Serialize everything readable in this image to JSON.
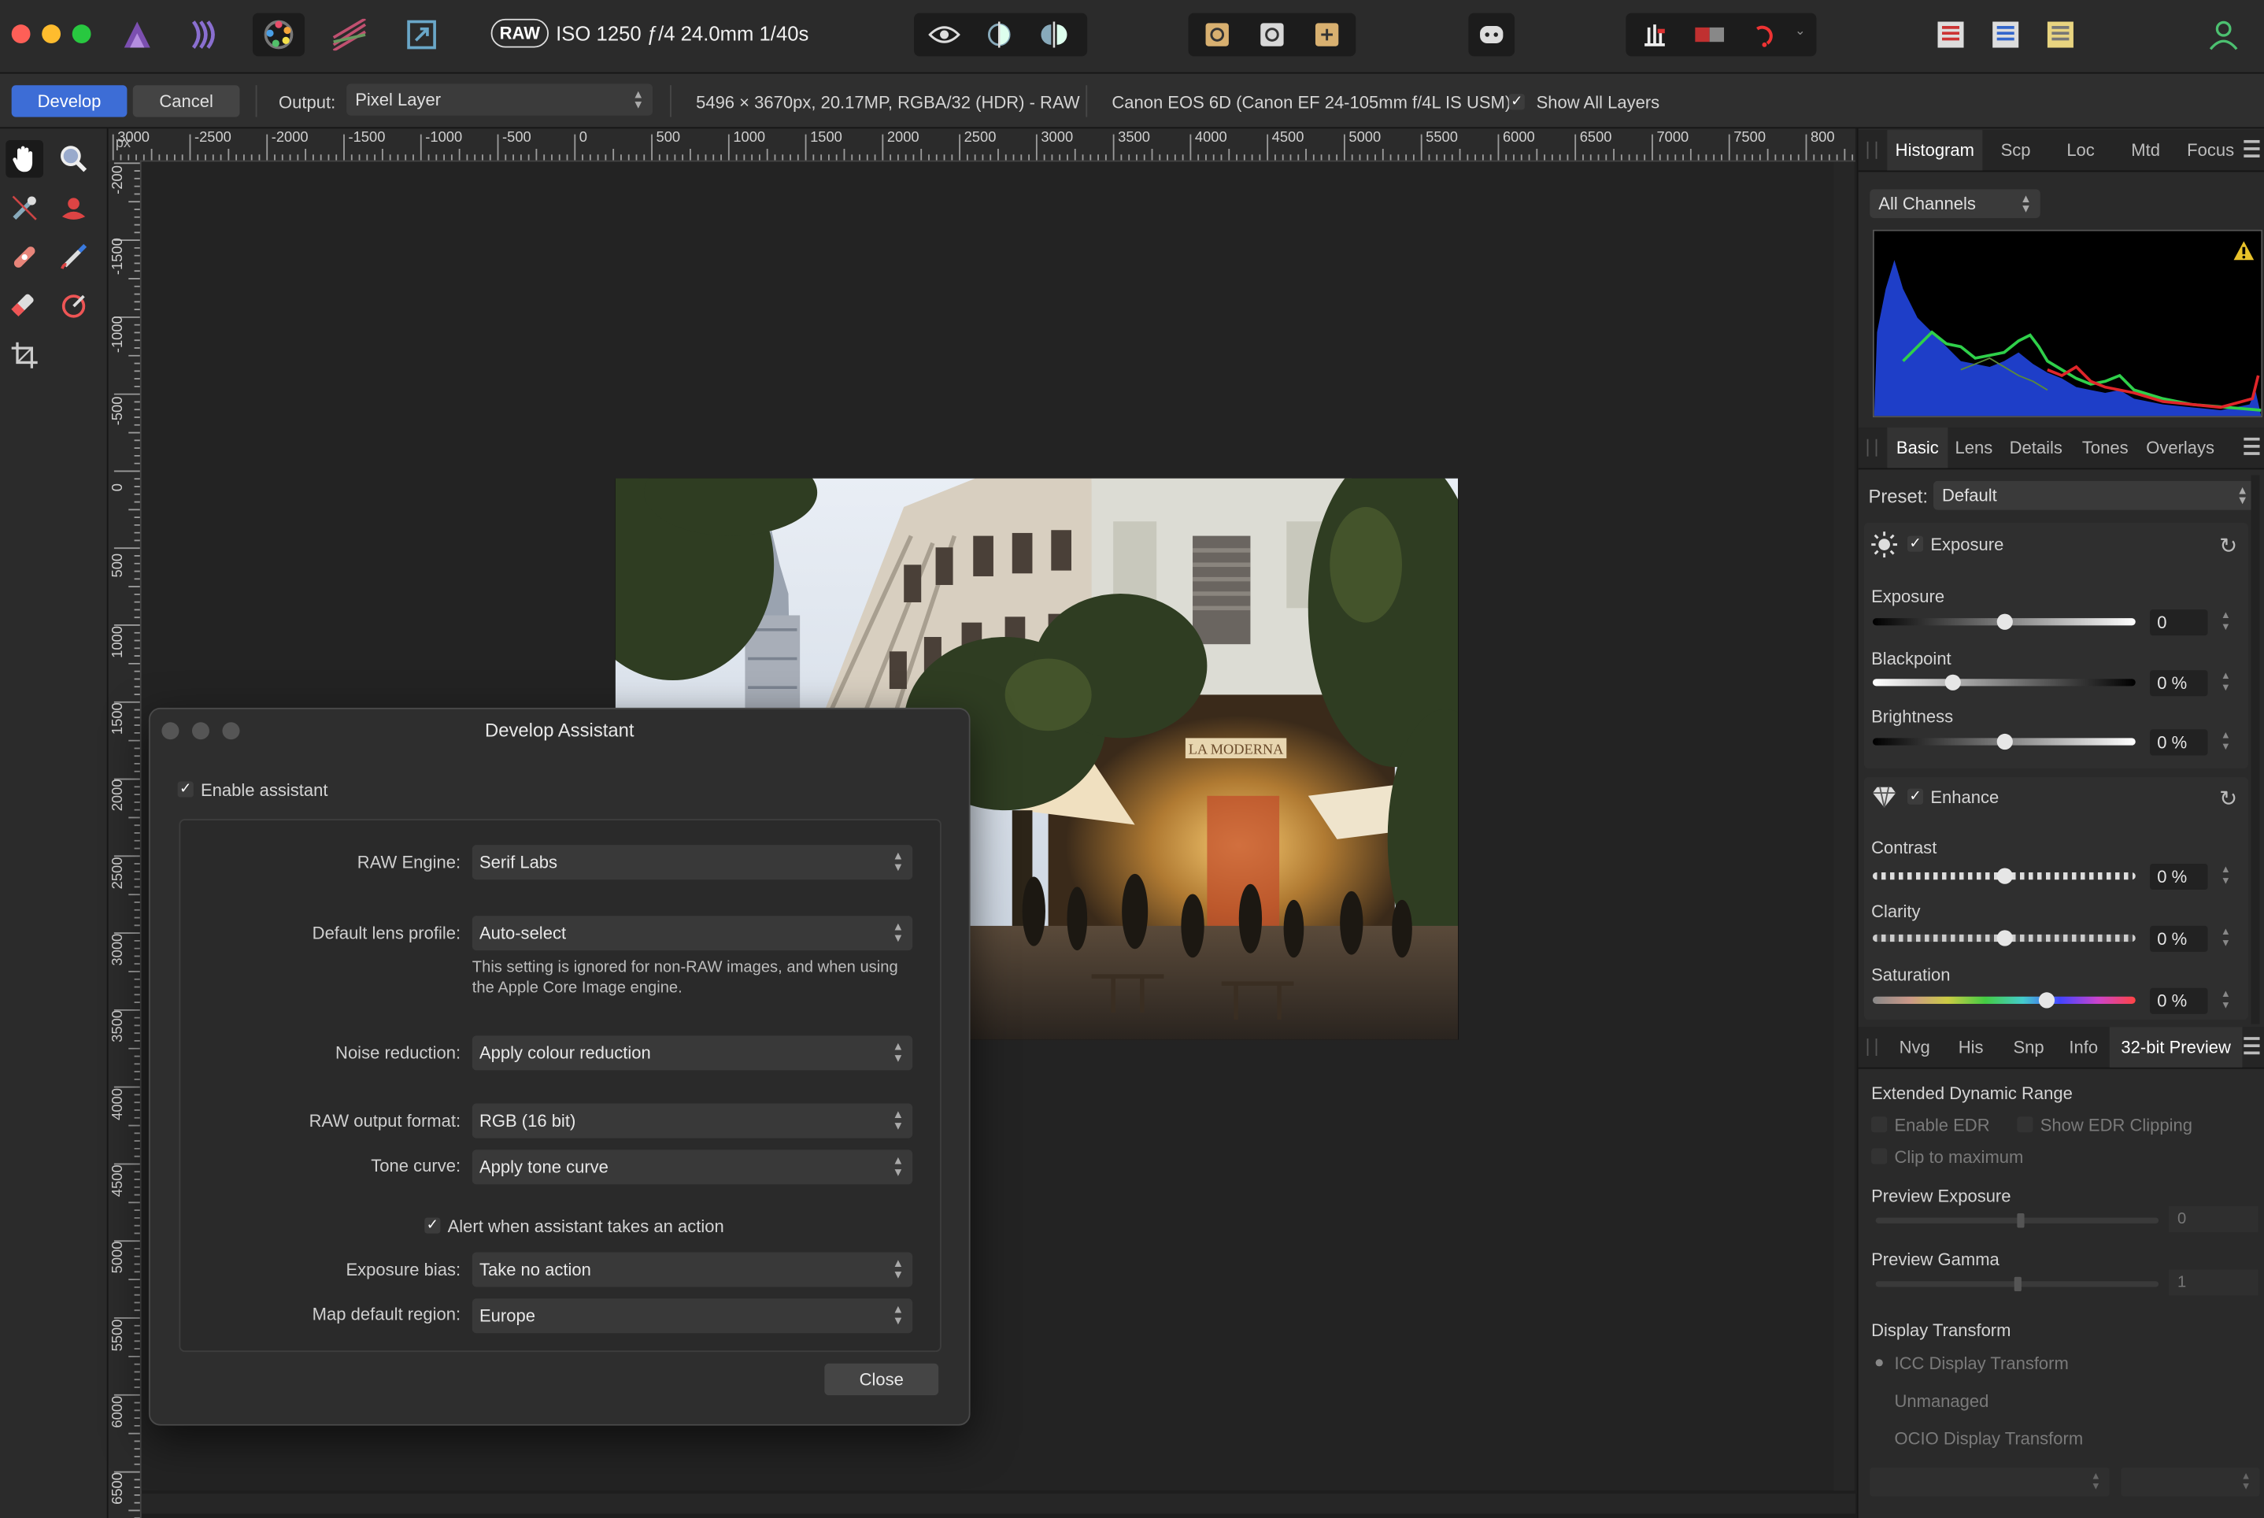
{
  "titlebar": {
    "raw_badge": "RAW",
    "exif": "ISO 1250 ƒ/4 24.0mm 1/40s"
  },
  "context": {
    "develop": "Develop",
    "cancel": "Cancel",
    "output_label": "Output:",
    "output_value": "Pixel Layer",
    "image_info": "5496 × 3670px, 20.17MP, RGBA/32 (HDR) - RAW",
    "camera_info": "Canon EOS 6D (Canon EF 24-105mm f/4L IS USM)",
    "show_all_layers": "Show All Layers"
  },
  "ruler": {
    "unit": "px",
    "h_ticks": [
      "3000",
      "-2500",
      "-2000",
      "-1500",
      "-1000",
      "-500",
      "0",
      "500",
      "1000",
      "1500",
      "2000",
      "2500",
      "3000",
      "3500",
      "4000",
      "4500",
      "5000",
      "5500",
      "6000",
      "6500",
      "7000",
      "7500",
      "800"
    ],
    "v_ticks": [
      "-200",
      "-1500",
      "-1000",
      "-500",
      "0",
      "500",
      "1000",
      "1500",
      "2000",
      "2500",
      "3000",
      "3500",
      "4000",
      "4500",
      "5000",
      "5500",
      "6000",
      "6500"
    ]
  },
  "histogram_panel": {
    "tabs": [
      "Histogram",
      "Scp",
      "Loc",
      "Mtd",
      "Focus"
    ],
    "channel": "All Channels"
  },
  "basic_panel": {
    "tabs": [
      "Basic",
      "Lens",
      "Details",
      "Tones",
      "Overlays"
    ],
    "preset_label": "Preset:",
    "preset_value": "Default",
    "exposure_group": {
      "title": "Exposure",
      "exposure": {
        "label": "Exposure",
        "value": "0",
        "level": 0.5
      },
      "blackpoint": {
        "label": "Blackpoint",
        "value": "0 %",
        "level": 0.3
      },
      "brightness": {
        "label": "Brightness",
        "value": "0 %",
        "level": 0.5
      }
    },
    "enhance_group": {
      "title": "Enhance",
      "contrast": {
        "label": "Contrast",
        "value": "0 %",
        "level": 0.5
      },
      "clarity": {
        "label": "Clarity",
        "value": "0 %",
        "level": 0.5
      },
      "saturation": {
        "label": "Saturation",
        "value": "0 %",
        "level": 0.66
      }
    }
  },
  "preview_panel": {
    "tabs": [
      "Nvg",
      "His",
      "Snp",
      "Info",
      "32-bit Preview"
    ],
    "edr_heading": "Extended Dynamic Range",
    "enable_edr": "Enable EDR",
    "show_edr_clipping": "Show EDR Clipping",
    "clip_to_max": "Clip to maximum",
    "preview_exposure": {
      "label": "Preview Exposure",
      "value": "0"
    },
    "preview_gamma": {
      "label": "Preview Gamma",
      "value": "1"
    },
    "display_transform": "Display Transform",
    "icc": "ICC Display Transform",
    "unmanaged": "Unmanaged",
    "ocio": "OCIO Display Transform"
  },
  "dialog": {
    "title": "Develop Assistant",
    "enable_assistant": "Enable assistant",
    "raw_engine": {
      "label": "RAW Engine:",
      "value": "Serif Labs"
    },
    "lens_profile": {
      "label": "Default lens profile:",
      "value": "Auto-select"
    },
    "lens_note": "This setting is ignored for non-RAW images, and when using the Apple Core Image engine.",
    "noise": {
      "label": "Noise reduction:",
      "value": "Apply colour reduction"
    },
    "output_format": {
      "label": "RAW output format:",
      "value": "RGB (16 bit)"
    },
    "tone_curve": {
      "label": "Tone curve:",
      "value": "Apply tone curve"
    },
    "alert": "Alert when assistant takes an action",
    "exposure_bias": {
      "label": "Exposure bias:",
      "value": "Take no action"
    },
    "map_region": {
      "label": "Map default region:",
      "value": "Europe"
    },
    "close": "Close"
  },
  "photo": {
    "sign_text": "LA MODERNA"
  },
  "colors": {
    "accent": "#3d6dd6",
    "warning": "#e8c22a"
  }
}
